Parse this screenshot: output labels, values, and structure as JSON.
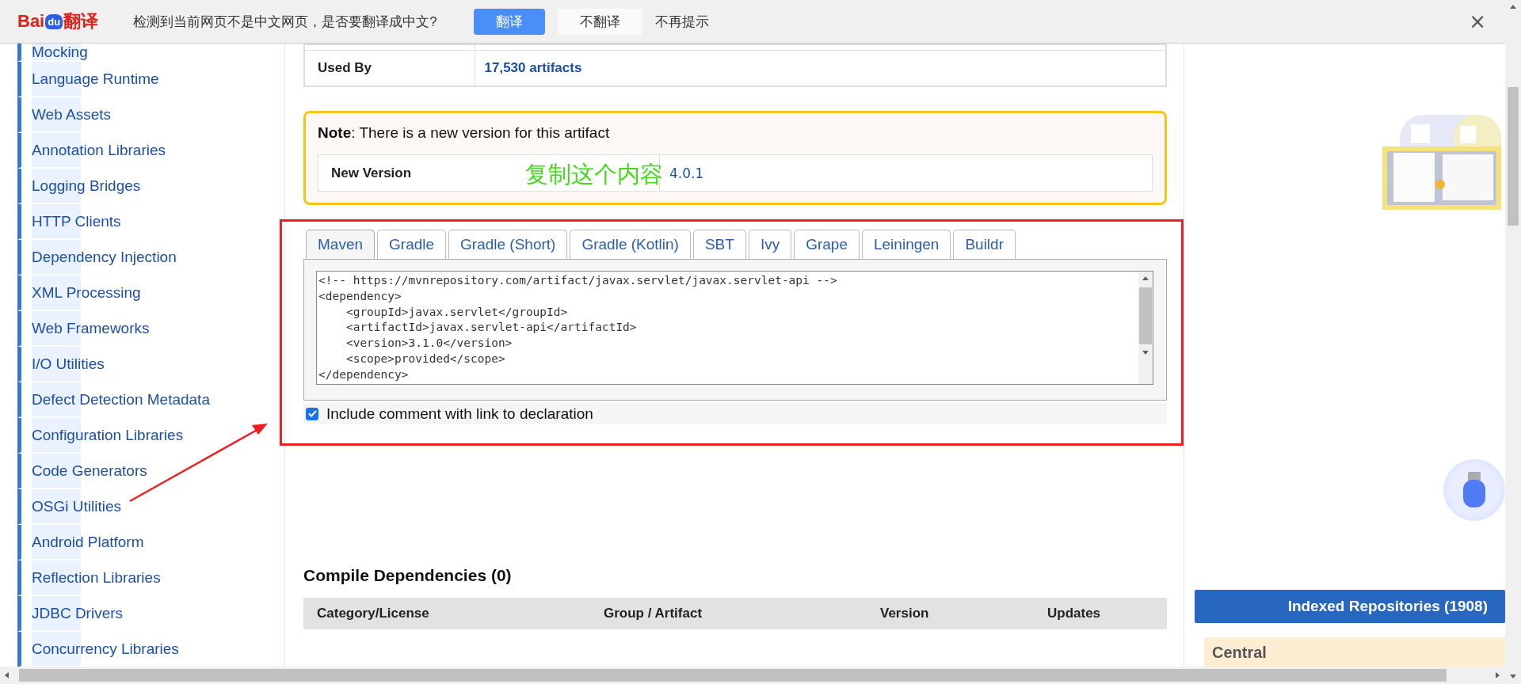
{
  "translate_bar": {
    "logo": {
      "red_part": "Bai",
      "paw_part": "du",
      "suffix": "翻译"
    },
    "message": "检测到当前网页不是中文网页，是否要翻译成中文?",
    "buttons": [
      {
        "label": "翻译",
        "kind": "primary"
      },
      {
        "label": "不翻译",
        "kind": "secondary"
      },
      {
        "label": "不再提示",
        "kind": "link"
      }
    ],
    "close": "×"
  },
  "sidebar": {
    "items": [
      "Mocking",
      "Language Runtime",
      "Web Assets",
      "Annotation Libraries",
      "Logging Bridges",
      "HTTP Clients",
      "Dependency Injection",
      "XML Processing",
      "Web Frameworks",
      "I/O Utilities",
      "Defect Detection Metadata",
      "Configuration Libraries",
      "Code Generators",
      "OSGi Utilities",
      "Android Platform",
      "Reflection Libraries",
      "JDBC Drivers",
      "Concurrency Libraries"
    ]
  },
  "info_table": {
    "rows": [
      {
        "label": "Used By",
        "value": "17,530 artifacts"
      }
    ]
  },
  "note": {
    "text": "**Note**: There is a new version for this artifact",
    "rows": [
      {
        "label": "New Version",
        "value": "4.0.1"
      }
    ],
    "annotation": "复制这个内容"
  },
  "snippet": {
    "tabs": [
      {
        "label": "Maven",
        "selected": true
      },
      {
        "label": "Gradle",
        "selected": false
      },
      {
        "label": "Gradle (Short)",
        "selected": false
      },
      {
        "label": "Gradle (Kotlin)",
        "selected": false
      },
      {
        "label": "SBT",
        "selected": false
      },
      {
        "label": "Ivy",
        "selected": false
      },
      {
        "label": "Grape",
        "selected": false
      },
      {
        "label": "Leiningen",
        "selected": false
      },
      {
        "label": "Buildr",
        "selected": false
      }
    ],
    "code": [
      "<!-- https://mvnrepository.com/artifact/javax.servlet/javax.servlet-api -->",
      "<dependency>",
      "    <groupId>javax.servlet</groupId>",
      "    <artifactId>javax.servlet-api</artifactId>",
      "    <version>3.1.0</version>",
      "    <scope>provided</scope>",
      "</dependency>"
    ],
    "include_comment": {
      "label": "Include comment with link to declaration",
      "checked": true
    }
  },
  "compile_dependencies": {
    "title": "Compile Dependencies (0)",
    "columns": [
      "Category/License",
      "Group / Artifact",
      "Version",
      "Updates"
    ]
  },
  "right_panel": {
    "repositories_button": "Indexed Repositories (1908)",
    "repositories": [
      "Central"
    ]
  }
}
